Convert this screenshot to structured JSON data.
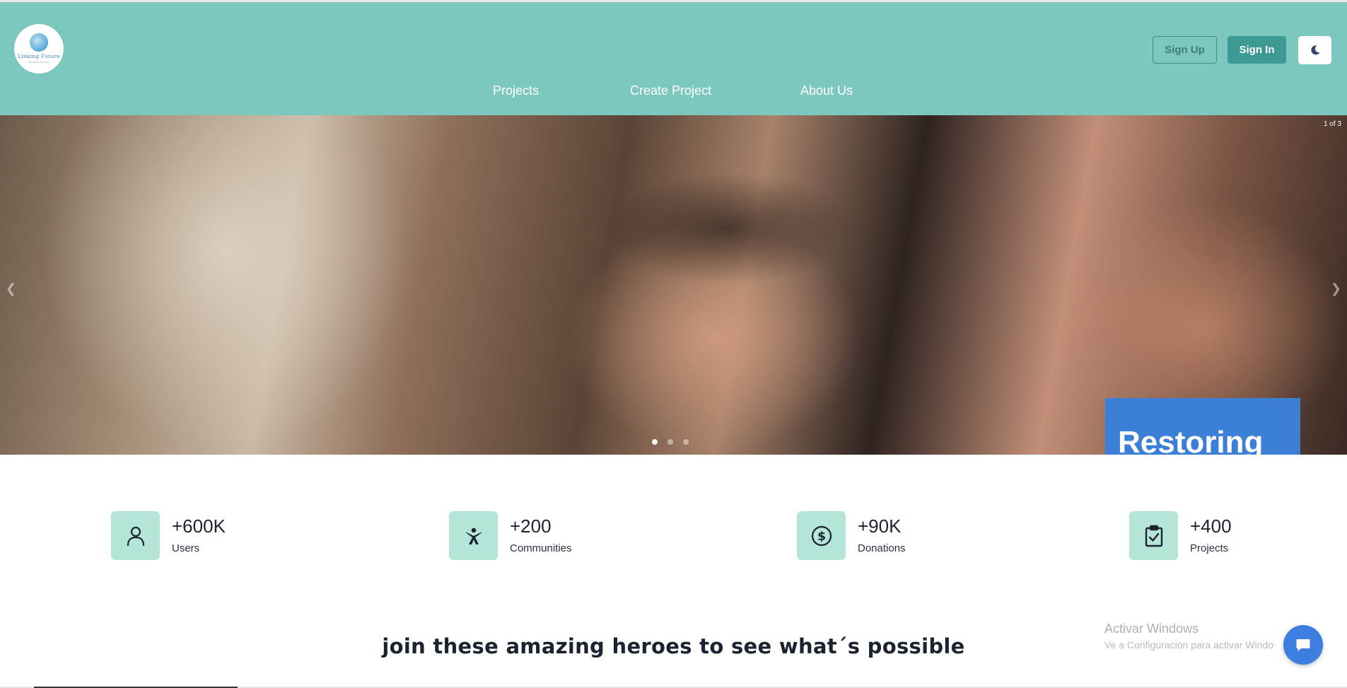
{
  "header": {
    "logo": {
      "title": "Linking Future",
      "subtitle": "the world need you"
    },
    "sign_up_label": "Sign Up",
    "sign_in_label": "Sign In",
    "theme_toggle_icon": "moon-icon",
    "nav": [
      {
        "label": "Projects"
      },
      {
        "label": "Create Project"
      },
      {
        "label": "About Us"
      }
    ],
    "background_color": "#7cc8bf"
  },
  "carousel": {
    "counter": "1 of 3",
    "current_slide": 1,
    "total_slides": 3,
    "caption": "Restoring",
    "caption_color": "#3b7fd6"
  },
  "stats": [
    {
      "icon": "user-icon",
      "value": "+600K",
      "label": "Users"
    },
    {
      "icon": "community-icon",
      "value": "+200",
      "label": "Communities"
    },
    {
      "icon": "dollar-coin-icon",
      "value": "+90K",
      "label": "Donations"
    },
    {
      "icon": "clipboard-check-icon",
      "value": "+400",
      "label": "Projects"
    }
  ],
  "tagline": "join these amazing heroes to see what´s possible",
  "watermark": {
    "title": "Activar Windows",
    "subtitle": "Ve a Configuración para activar Windows."
  },
  "chat_button_icon": "chat-bubble-icon",
  "colors": {
    "accent": "#3c9994",
    "stat_tile": "#b5e5d9",
    "chat": "#3d7fe0"
  }
}
